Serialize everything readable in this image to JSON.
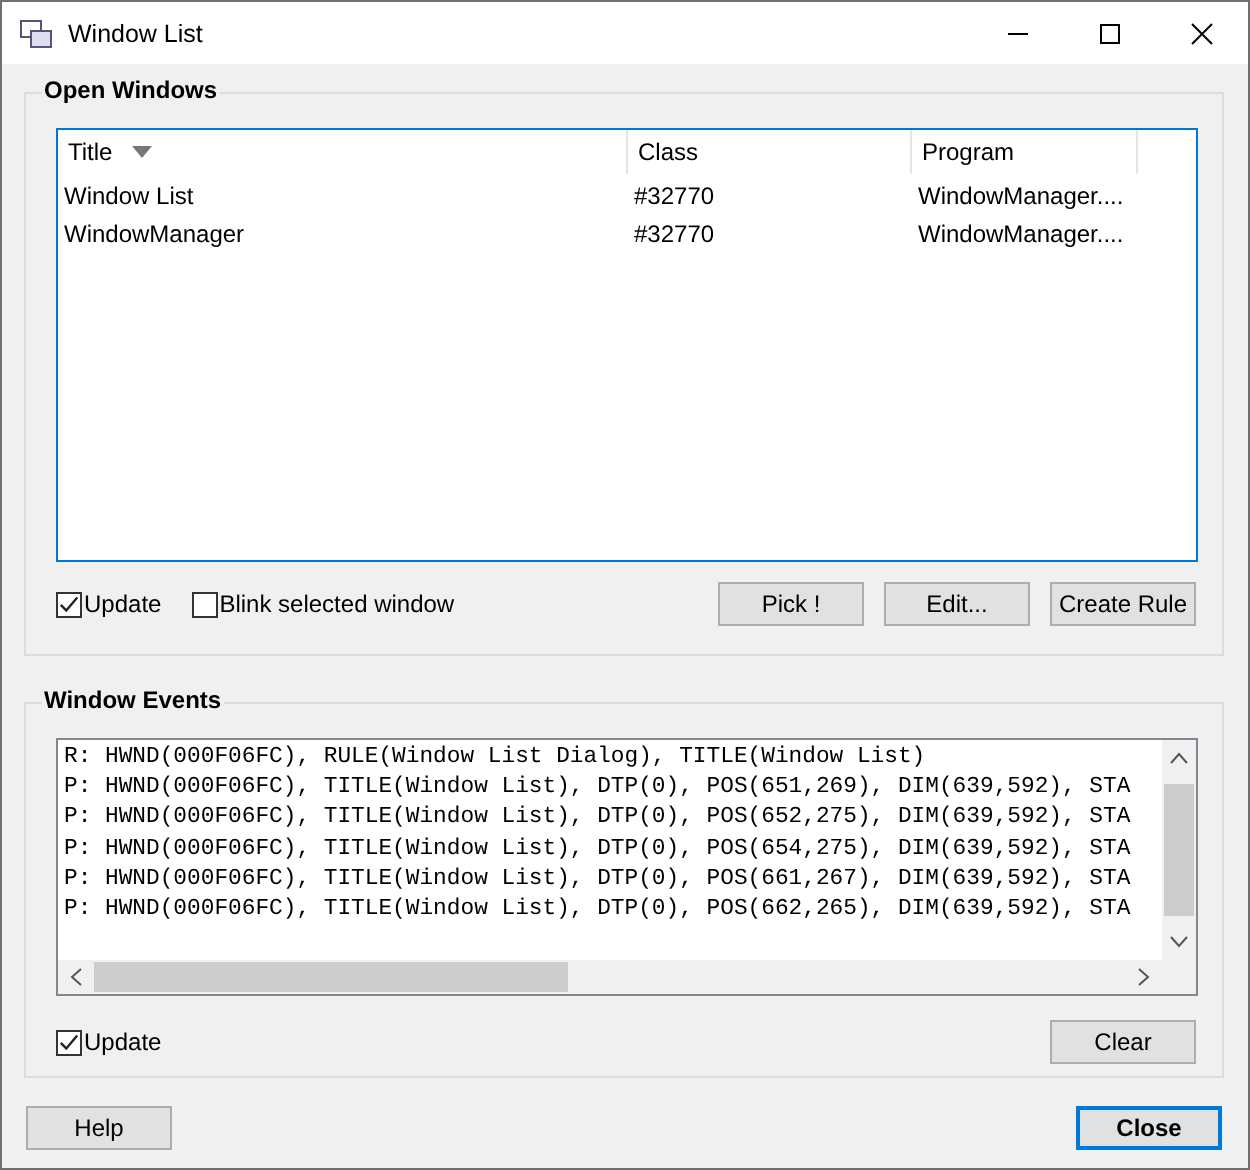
{
  "window": {
    "title": "Window List"
  },
  "open_windows": {
    "title": "Open Windows",
    "columns": [
      {
        "label": "Title",
        "sorted": true
      },
      {
        "label": "Class",
        "sorted": false
      },
      {
        "label": "Program",
        "sorted": false
      }
    ],
    "rows": [
      [
        "Window List",
        "#32770",
        "WindowManager...."
      ],
      [
        "WindowManager",
        "#32770",
        "WindowManager...."
      ]
    ],
    "checks": [
      {
        "label": "Update",
        "checked": true
      },
      {
        "label": "Blink selected window",
        "checked": false
      }
    ],
    "buttons": [
      {
        "label": "Pick !",
        "default": false
      },
      {
        "label": "Edit...",
        "default": false
      },
      {
        "label": "Create Rule",
        "default": false
      }
    ]
  },
  "window_events": {
    "title": "Window Events",
    "lines": [
      "R: HWND(000F06FC), RULE(Window List Dialog), TITLE(Window List)",
      "P: HWND(000F06FC), TITLE(Window List), DTP(0), POS(651,269), DIM(639,592), STA",
      "P: HWND(000F06FC), TITLE(Window List), DTP(0), POS(652,275), DIM(639,592), STA",
      "P: HWND(000F06FC), TITLE(Window List), DTP(0), POS(654,275), DIM(639,592), STA",
      "P: HWND(000F06FC), TITLE(Window List), DTP(0), POS(661,267), DIM(639,592), STA",
      "P: HWND(000F06FC), TITLE(Window List), DTP(0), POS(662,265), DIM(639,592), STA"
    ],
    "checks": [
      {
        "label": "Update",
        "checked": true
      }
    ],
    "buttons": [
      {
        "label": "Clear",
        "default": false
      }
    ]
  },
  "footer": {
    "buttons": [
      {
        "label": "Help",
        "default": false
      },
      {
        "label": "Close",
        "default": true
      }
    ]
  }
}
